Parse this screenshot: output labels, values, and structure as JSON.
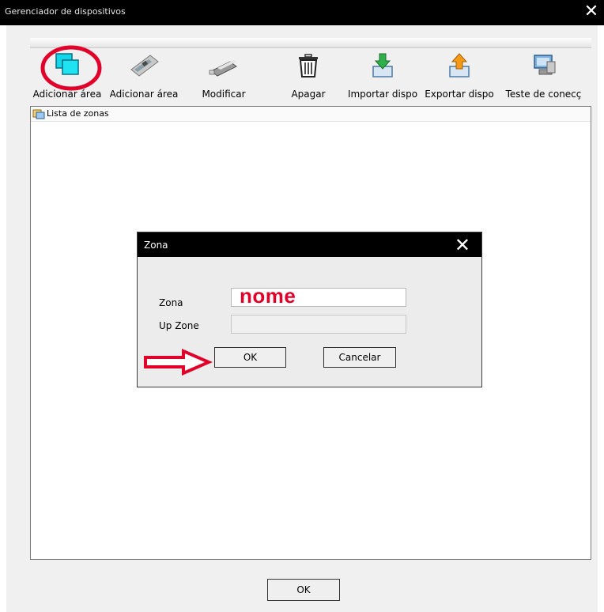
{
  "window": {
    "title": "Gerenciador de dispositivos",
    "close_glyph": "✕"
  },
  "toolbar": {
    "buttons": [
      {
        "label": "Adicionar área",
        "icon": "add-area-icon"
      },
      {
        "label": "Adicionar área",
        "icon": "network-card-icon"
      },
      {
        "label": "Modificar",
        "icon": "usb-drive-icon"
      },
      {
        "label": "Apagar",
        "icon": "trash-icon"
      },
      {
        "label": "Importar dispo",
        "icon": "import-icon"
      },
      {
        "label": "Exportar dispo",
        "icon": "export-icon"
      },
      {
        "label": "Teste de conecç",
        "icon": "connection-test-icon"
      }
    ]
  },
  "list": {
    "header": "Lista de zonas"
  },
  "footer": {
    "ok_label": "OK"
  },
  "dialog": {
    "title": "Zona",
    "close_glyph": "✕",
    "zona_label": "Zona",
    "zona_value": "nome",
    "upzone_label": "Up Zone",
    "upzone_value": "",
    "ok_label": "OK",
    "cancel_label": "Cancelar"
  },
  "colors": {
    "annotation": "#e0002a",
    "titlebar": "#000000",
    "window_bg": "#f0f0f0"
  }
}
